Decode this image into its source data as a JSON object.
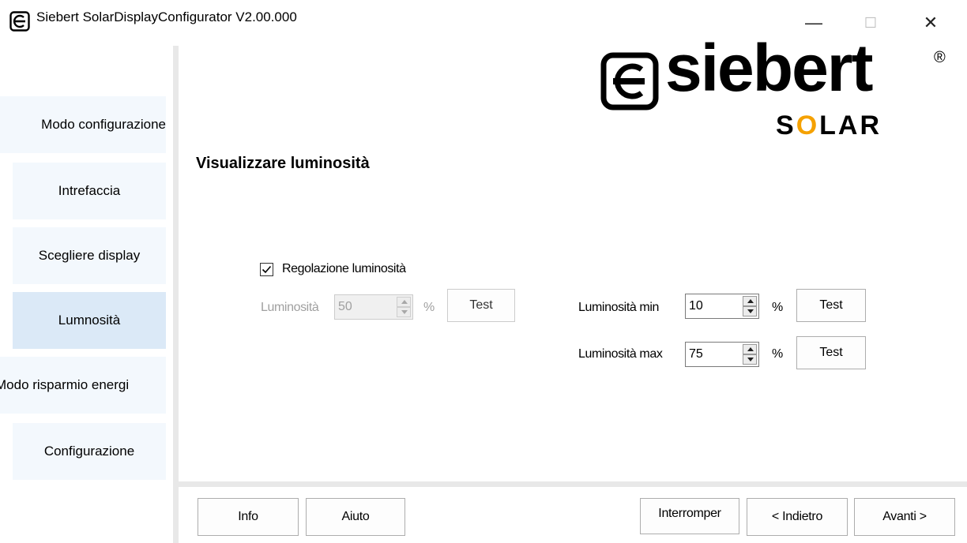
{
  "window": {
    "title": "Siebert SolarDisplayConfigurator V2.00.000",
    "minimize_glyph": "—",
    "maximize_glyph": "☐",
    "close_glyph": "✕"
  },
  "sidebar": {
    "items": [
      {
        "label": "Modo configurazione"
      },
      {
        "label": "Intrefaccia"
      },
      {
        "label": "Scegliere display"
      },
      {
        "label": "Lumnosità"
      },
      {
        "label": "Modo risparmio energi"
      },
      {
        "label": "Configurazione"
      }
    ],
    "active_index": 3
  },
  "logo": {
    "brand": "siebert",
    "registered": "®",
    "product_left": "S",
    "product_o": "O",
    "product_right": "LAR",
    "accent_color": "#f5a100"
  },
  "main": {
    "section_title": "Visualizzare luminosità",
    "auto_brightness": {
      "label": "Regolazione luminosità",
      "checked": true
    },
    "brightness": {
      "label": "Luminosità",
      "value": "50",
      "unit": "%",
      "test_label": "Test",
      "enabled": false
    },
    "brightness_min": {
      "label": "Luminosità min",
      "value": "10",
      "unit": "%",
      "test_label": "Test"
    },
    "brightness_max": {
      "label": "Luminosità max",
      "value": "75",
      "unit": "%",
      "test_label": "Test"
    }
  },
  "footer": {
    "info_label": "Info",
    "help_label": "Aiuto",
    "cancel_label": "Interromper",
    "back_label": "< Indietro",
    "next_label": "Avanti >"
  },
  "icons": [
    "app-icon",
    "checkmark-icon",
    "spin-up-icon",
    "spin-down-icon",
    "siebert-logo-icon"
  ]
}
